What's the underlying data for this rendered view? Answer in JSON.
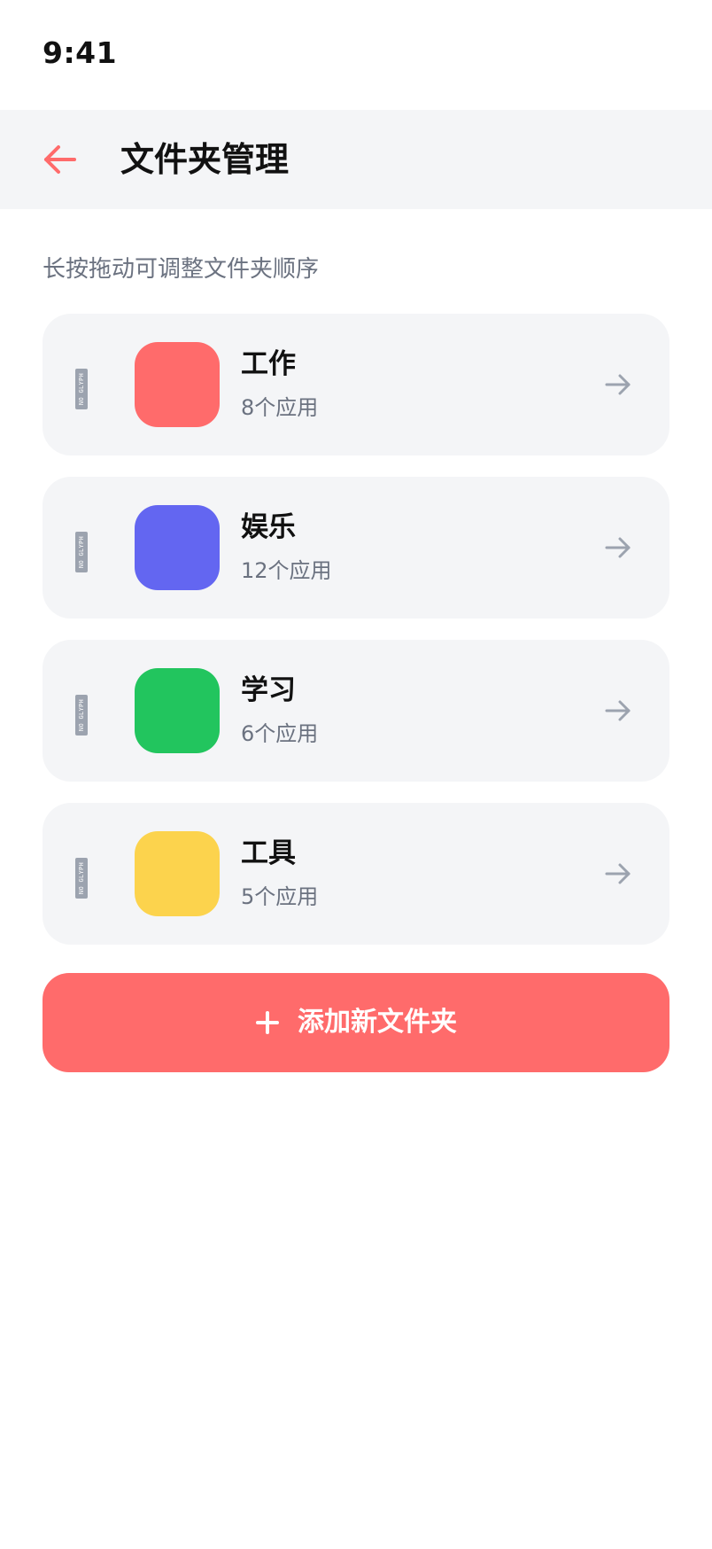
{
  "status_bar": {
    "time": "9:41"
  },
  "header": {
    "title": "文件夹管理",
    "back_icon": "arrow-left-icon",
    "accent": "#ff6b6b"
  },
  "hint": "长按拖动可调整文件夹顺序",
  "folders": [
    {
      "name": "工作",
      "count": "8个应用",
      "color": "#ff6b6b"
    },
    {
      "name": "娱乐",
      "count": "12个应用",
      "color": "#6366f1"
    },
    {
      "name": "学习",
      "count": "6个应用",
      "color": "#22c55e"
    },
    {
      "name": "工具",
      "count": "5个应用",
      "color": "#fcd34d"
    }
  ],
  "drag_handle_glyph": "NO GLYPH",
  "add_button": {
    "label": "添加新文件夹",
    "icon": "plus-icon",
    "color": "#ff6b6b"
  }
}
